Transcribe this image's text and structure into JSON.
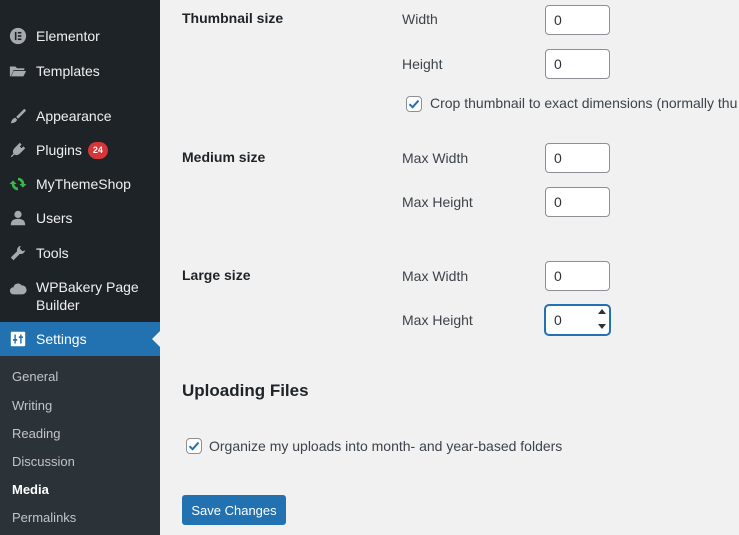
{
  "sidebar": {
    "items": [
      {
        "label": "Elementor",
        "icon": "elementor-icon"
      },
      {
        "label": "Templates",
        "icon": "folder-icon"
      },
      {
        "label": "Appearance",
        "icon": "paintbrush-icon"
      },
      {
        "label": "Plugins",
        "icon": "plugin-icon",
        "badge": "24"
      },
      {
        "label": "MyThemeShop",
        "icon": "refresh-icon"
      },
      {
        "label": "Users",
        "icon": "user-icon"
      },
      {
        "label": "Tools",
        "icon": "wrench-icon"
      },
      {
        "label_line1": "WPBakery Page",
        "label_line2": "Builder",
        "icon": "cloud-icon"
      },
      {
        "label": "Settings",
        "icon": "settings-sliders-icon",
        "active": true
      }
    ],
    "submenu": [
      "General",
      "Writing",
      "Reading",
      "Discussion",
      "Media",
      "Permalinks"
    ],
    "current_submenu": "Media"
  },
  "thumbnail": {
    "title": "Thumbnail size",
    "width_label": "Width",
    "width_value": "0",
    "height_label": "Height",
    "height_value": "0",
    "crop_label": "Crop thumbnail to exact dimensions (normally thu",
    "crop_checked": true
  },
  "medium": {
    "title": "Medium size",
    "max_width_label": "Max Width",
    "max_width_value": "0",
    "max_height_label": "Max Height",
    "max_height_value": "0"
  },
  "large": {
    "title": "Large size",
    "max_width_label": "Max Width",
    "max_width_value": "0",
    "max_height_label": "Max Height",
    "max_height_value": "0"
  },
  "uploading": {
    "title": "Uploading Files",
    "organize_label": "Organize my uploads into month- and year-based folders",
    "organize_checked": true
  },
  "save_label": "Save Changes",
  "colors": {
    "sidebar_bg": "#1d2327",
    "submenu_bg": "#2c3338",
    "accent": "#2271b1",
    "badge": "#d63638",
    "page_bg": "#f1f1f1"
  }
}
